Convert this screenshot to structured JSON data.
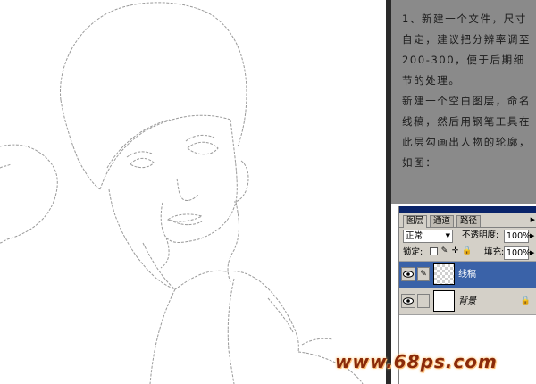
{
  "instructions": {
    "p1": "1、新建一个文件，尺寸自定，建议把分辨率调至200-300，便于后期细节的处理。",
    "p2": "新建一个空白图层，命名线稿，然后用钢笔工具在此层勾画出人物的轮廓，如图："
  },
  "layers_panel": {
    "tabs": [
      "图层",
      "通道",
      "路径"
    ],
    "active_tab": "图层",
    "blend_mode": "正常",
    "opacity_label": "不透明度:",
    "opacity_value": "100%",
    "lock_label": "锁定:",
    "fill_label": "填充:",
    "fill_value": "100%",
    "layers": [
      {
        "name": "线稿",
        "selected": true,
        "thumbnail": "transparent",
        "icon": "brush-icon"
      },
      {
        "name": "背景",
        "selected": false,
        "thumbnail": "white",
        "icon": "lock-icon"
      }
    ]
  },
  "watermark": "www.68ps.com",
  "colors": {
    "instructions_bg": "#8a8a8a",
    "panel_bg": "#d4d0c8",
    "selected_layer": "#3a62a8",
    "watermark": "#8a2a0a"
  }
}
